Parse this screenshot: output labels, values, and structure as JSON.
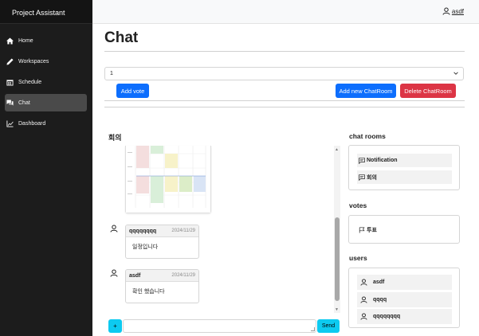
{
  "brand": "Project Assistant",
  "nav": [
    {
      "label": "Home",
      "icon": "home-icon"
    },
    {
      "label": "Workspaces",
      "icon": "pencil-icon"
    },
    {
      "label": "Schedule",
      "icon": "calendar-icon"
    },
    {
      "label": "Chat",
      "icon": "chat-icon",
      "active": true
    },
    {
      "label": "Dashboard",
      "icon": "graph-icon"
    }
  ],
  "user": {
    "name": "asdf"
  },
  "page": {
    "title": "Chat"
  },
  "room_select": {
    "value": "1"
  },
  "buttons": {
    "add_vote": "Add vote",
    "add_room": "Add new ChatRoom",
    "delete_room": "Delete ChatRoom"
  },
  "chat": {
    "title": "회의",
    "messages": [
      {
        "name": "qqqqqqqq",
        "date": "2024/11/29",
        "text": "일정입니다"
      },
      {
        "name": "asdf",
        "date": "2024/11/29",
        "text": "확인 했습니다"
      }
    ],
    "plus_label": "+",
    "send_label": "Send"
  },
  "sidebar_right": {
    "rooms_title": "chat rooms",
    "rooms": [
      "Notification",
      "회의"
    ],
    "votes_title": "votes",
    "votes": [
      "투표"
    ],
    "users_title": "users",
    "users": [
      "asdf",
      "qqqq",
      "qqqqqqqq"
    ]
  },
  "colors": {
    "sidebar": "#1c1c1c",
    "primary": "#0d6efd",
    "danger": "#dc3545",
    "info": "#0dcaf0"
  }
}
